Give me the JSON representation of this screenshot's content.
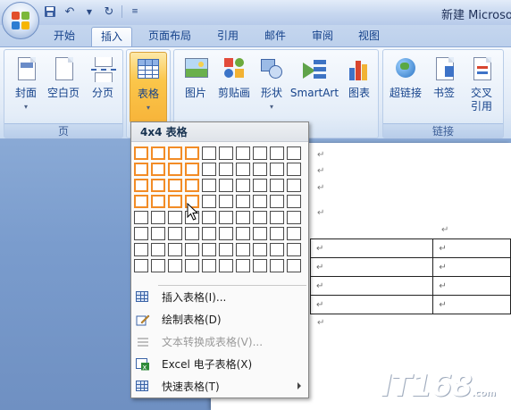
{
  "window": {
    "title": "新建 Microsoft"
  },
  "tabs": [
    {
      "label": "开始"
    },
    {
      "label": "插入",
      "active": true
    },
    {
      "label": "页面布局"
    },
    {
      "label": "引用"
    },
    {
      "label": "邮件"
    },
    {
      "label": "审阅"
    },
    {
      "label": "视图"
    }
  ],
  "ribbon": {
    "pages_group": {
      "label": "页",
      "cover": "封面",
      "blank_page": "空白页",
      "page_break": "分页"
    },
    "tables_group": {
      "table": "表格"
    },
    "illustrations_group": {
      "picture": "图片",
      "clipart": "剪贴画",
      "shapes": "形状",
      "smartart": "SmartArt",
      "chart": "图表"
    },
    "links_group": {
      "label": "链接",
      "hyperlink": "超链接",
      "bookmark": "书签",
      "cross_ref_line1": "交叉",
      "cross_ref_line2": "引用"
    }
  },
  "dropdown": {
    "header": "4x4 表格",
    "grid": {
      "columns": 10,
      "rows": 8,
      "selected_columns": 4,
      "selected_rows": 4
    },
    "items": [
      {
        "label": "插入表格(I)...",
        "enabled": true
      },
      {
        "label": "绘制表格(D)",
        "enabled": true
      },
      {
        "label": "文本转换成表格(V)...",
        "enabled": false
      },
      {
        "label": "Excel 电子表格(X)",
        "enabled": true
      },
      {
        "label": "快速表格(T)",
        "enabled": true,
        "submenu": true
      }
    ]
  },
  "document": {
    "paragraph_mark": "↵"
  },
  "watermark": {
    "text": "IT168",
    "suffix": ".com"
  },
  "colors": {
    "selection_orange": "#f28c26",
    "ribbon_blue": "#15428b",
    "pressed_gold": "#fbc64a"
  }
}
